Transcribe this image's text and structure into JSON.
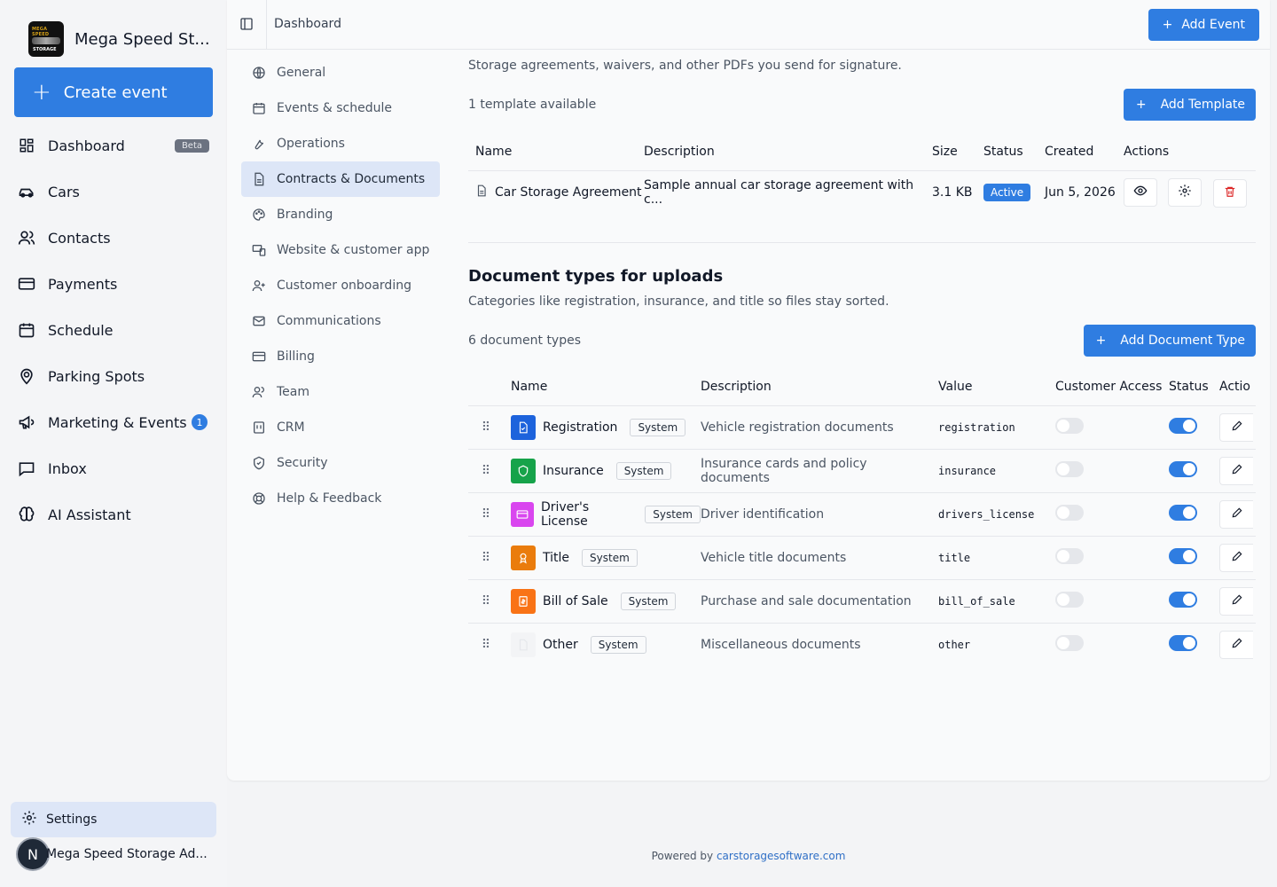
{
  "brand": {
    "name": "Mega Speed St...",
    "logo_top": "MEGA SPEED",
    "logo_bottom": "STORAGE"
  },
  "sidebar": {
    "create_label": "Create event",
    "items": [
      {
        "label": "Dashboard",
        "icon": "dashboard-icon",
        "badge": "Beta"
      },
      {
        "label": "Cars",
        "icon": "car-icon"
      },
      {
        "label": "Contacts",
        "icon": "users-icon"
      },
      {
        "label": "Payments",
        "icon": "credit-card-icon"
      },
      {
        "label": "Schedule",
        "icon": "calendar-icon"
      },
      {
        "label": "Parking Spots",
        "icon": "map-pin-icon"
      },
      {
        "label": "Marketing & Events",
        "icon": "megaphone-icon",
        "count": "1"
      },
      {
        "label": "Inbox",
        "icon": "inbox-icon"
      },
      {
        "label": "AI Assistant",
        "icon": "brain-icon"
      }
    ],
    "settings_label": "Settings",
    "user_initial": "N",
    "user_name": "Mega Speed Storage Ad..."
  },
  "topbar": {
    "breadcrumb": "Dashboard",
    "add_event": "Add Event"
  },
  "subnav": [
    {
      "label": "General",
      "icon": "globe-icon"
    },
    {
      "label": "Events & schedule",
      "icon": "calendar-icon"
    },
    {
      "label": "Operations",
      "icon": "wrench-icon"
    },
    {
      "label": "Contracts & Documents",
      "icon": "file-icon",
      "active": true
    },
    {
      "label": "Branding",
      "icon": "palette-icon"
    },
    {
      "label": "Website & customer app",
      "icon": "devices-icon"
    },
    {
      "label": "Customer onboarding",
      "icon": "user-plus-icon"
    },
    {
      "label": "Communications",
      "icon": "mail-icon"
    },
    {
      "label": "Billing",
      "icon": "credit-card-icon"
    },
    {
      "label": "Team",
      "icon": "team-icon"
    },
    {
      "label": "CRM",
      "icon": "crm-icon"
    },
    {
      "label": "Security",
      "icon": "shield-icon"
    },
    {
      "label": "Help & Feedback",
      "icon": "lifebuoy-icon"
    }
  ],
  "templates": {
    "subtitle": "Storage agreements, waivers, and other PDFs you send for signature.",
    "count": "1 template available",
    "add_label": "Add Template",
    "headers": [
      "Name",
      "Description",
      "Size",
      "Status",
      "Created",
      "Actions"
    ],
    "rows": [
      {
        "name": "Car Storage Agreement",
        "description": "Sample annual car storage agreement with c...",
        "size": "3.1 KB",
        "status": "Active",
        "created": "Jun 5, 2026"
      }
    ]
  },
  "doc_types": {
    "title": "Document types for uploads",
    "subtitle": "Categories like registration, insurance, and title so files stay sorted.",
    "count": "6 document types",
    "add_label": "Add Document Type",
    "headers": [
      "Name",
      "Description",
      "Value",
      "Customer Access",
      "Status",
      "Actio"
    ],
    "tag": "System",
    "rows": [
      {
        "name": "Registration",
        "description": "Vehicle registration documents",
        "value": "registration",
        "color": "#1d63dc",
        "icon": "file-icon",
        "customer_access": false,
        "status": true
      },
      {
        "name": "Insurance",
        "description": "Insurance cards and policy documents",
        "value": "insurance",
        "color": "#16a34a",
        "icon": "shield-icon",
        "customer_access": false,
        "status": true
      },
      {
        "name": "Driver's License",
        "description": "Driver identification",
        "value": "drivers_license",
        "color": "#d946ef",
        "icon": "id-card-icon",
        "customer_access": false,
        "status": true
      },
      {
        "name": "Title",
        "description": "Vehicle title documents",
        "value": "title",
        "color": "#ea7c0c",
        "icon": "award-icon",
        "customer_access": false,
        "status": true
      },
      {
        "name": "Bill of Sale",
        "description": "Purchase and sale documentation",
        "value": "bill_of_sale",
        "color": "#f97316",
        "icon": "receipt-icon",
        "customer_access": false,
        "status": true
      },
      {
        "name": "Other",
        "description": "Miscellaneous documents",
        "value": "other",
        "color": "#f3f4f6",
        "icon": "file-icon",
        "customer_access": false,
        "status": true
      }
    ]
  },
  "footer": {
    "prefix": "Powered by ",
    "link": "carstoragesoftware.com"
  }
}
